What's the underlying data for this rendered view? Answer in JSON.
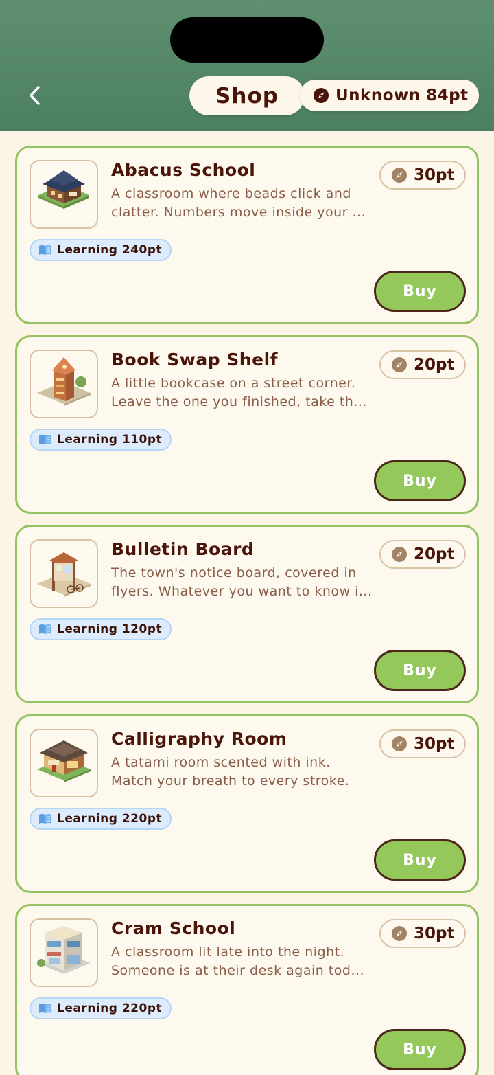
{
  "header": {
    "title": "Shop",
    "points_label": "Unknown 84pt"
  },
  "items": [
    {
      "name": "Abacus School",
      "desc_line1": "A classroom where beads click and",
      "desc_line2": "clatter. Numbers move inside your ...",
      "price": "30pt",
      "tag": "Learning 240pt",
      "buy_label": "Buy"
    },
    {
      "name": "Book Swap Shelf",
      "desc_line1": "A little bookcase on a street corner.",
      "desc_line2": "Leave the one you finished, take th...",
      "price": "20pt",
      "tag": "Learning 110pt",
      "buy_label": "Buy"
    },
    {
      "name": "Bulletin Board",
      "desc_line1": "The town's notice board, covered in",
      "desc_line2": "flyers. Whatever you want to know i...",
      "price": "20pt",
      "tag": "Learning 120pt",
      "buy_label": "Buy"
    },
    {
      "name": "Calligraphy Room",
      "desc_line1": "A tatami room scented with ink.",
      "desc_line2": "Match your breath to every stroke.",
      "price": "30pt",
      "tag": "Learning 220pt",
      "buy_label": "Buy"
    },
    {
      "name": "Cram School",
      "desc_line1": "A classroom lit late into the night.",
      "desc_line2": "Someone is at their desk again tod...",
      "price": "30pt",
      "tag": "Learning 220pt",
      "buy_label": "Buy"
    }
  ],
  "colors": {
    "header_bg": "#4c7f60",
    "card_border": "#94c461",
    "buy_bg": "#94c85a",
    "tag_bg": "#dcecfd",
    "title_text": "#4a1409"
  },
  "icons": {
    "back": "chevron-left-icon",
    "currency": "compass-icon",
    "category": "book-icon"
  }
}
